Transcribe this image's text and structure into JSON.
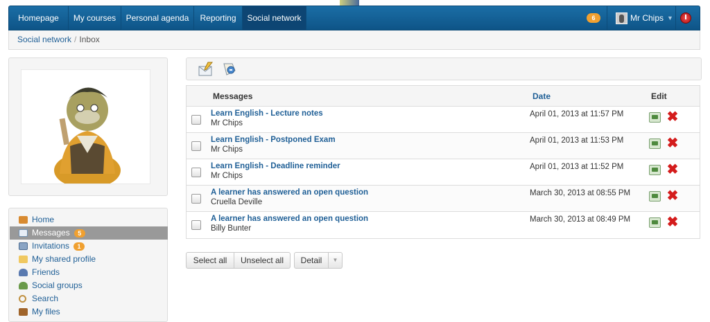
{
  "nav": {
    "items": [
      {
        "label": "Homepage"
      },
      {
        "label": "My courses"
      },
      {
        "label": "Personal agenda"
      },
      {
        "label": "Reporting"
      },
      {
        "label": "Social network"
      }
    ],
    "notification_count": "6",
    "user_name": "Mr Chips"
  },
  "breadcrumb": {
    "parent": "Social network",
    "separator": "/",
    "current": "Inbox"
  },
  "sidebar": {
    "items": [
      {
        "label": "Home",
        "icon": "home-icon"
      },
      {
        "label": "Messages",
        "badge": "5",
        "icon": "envelope-icon"
      },
      {
        "label": "Invitations",
        "badge": "1",
        "icon": "invitation-icon"
      },
      {
        "label": "My shared profile",
        "icon": "folder-icon"
      },
      {
        "label": "Friends",
        "icon": "user-icon"
      },
      {
        "label": "Social groups",
        "icon": "group-icon"
      },
      {
        "label": "Search",
        "icon": "search-icon"
      },
      {
        "label": "My files",
        "icon": "briefcase-icon"
      }
    ]
  },
  "toolbar": {
    "icons": [
      "compose-message-icon",
      "outbox-icon"
    ]
  },
  "table": {
    "headers": {
      "messages": "Messages",
      "date": "Date",
      "edit": "Edit"
    },
    "rows": [
      {
        "subject": "Learn English - Lecture notes",
        "sender": "Mr Chips",
        "date": "April 01, 2013 at 11:57 PM"
      },
      {
        "subject": "Learn English - Postponed Exam",
        "sender": "Mr Chips",
        "date": "April 01, 2013 at 11:53 PM"
      },
      {
        "subject": "Learn English - Deadline reminder",
        "sender": "Mr Chips",
        "date": "April 01, 2013 at 11:52 PM"
      },
      {
        "subject": "A learner has answered an open question",
        "sender": "Cruella Deville",
        "date": "March 30, 2013 at 08:55 PM"
      },
      {
        "subject": "A learner has answered an open question",
        "sender": "Billy Bunter",
        "date": "March 30, 2013 at 08:49 PM"
      }
    ]
  },
  "actions": {
    "select_all": "Select all",
    "unselect_all": "Unselect all",
    "detail": "Detail"
  },
  "colors": {
    "nav_bg": "#1b6ea6",
    "link": "#1f5f96",
    "badge": "#f0a030",
    "delete": "#d41c1c"
  }
}
